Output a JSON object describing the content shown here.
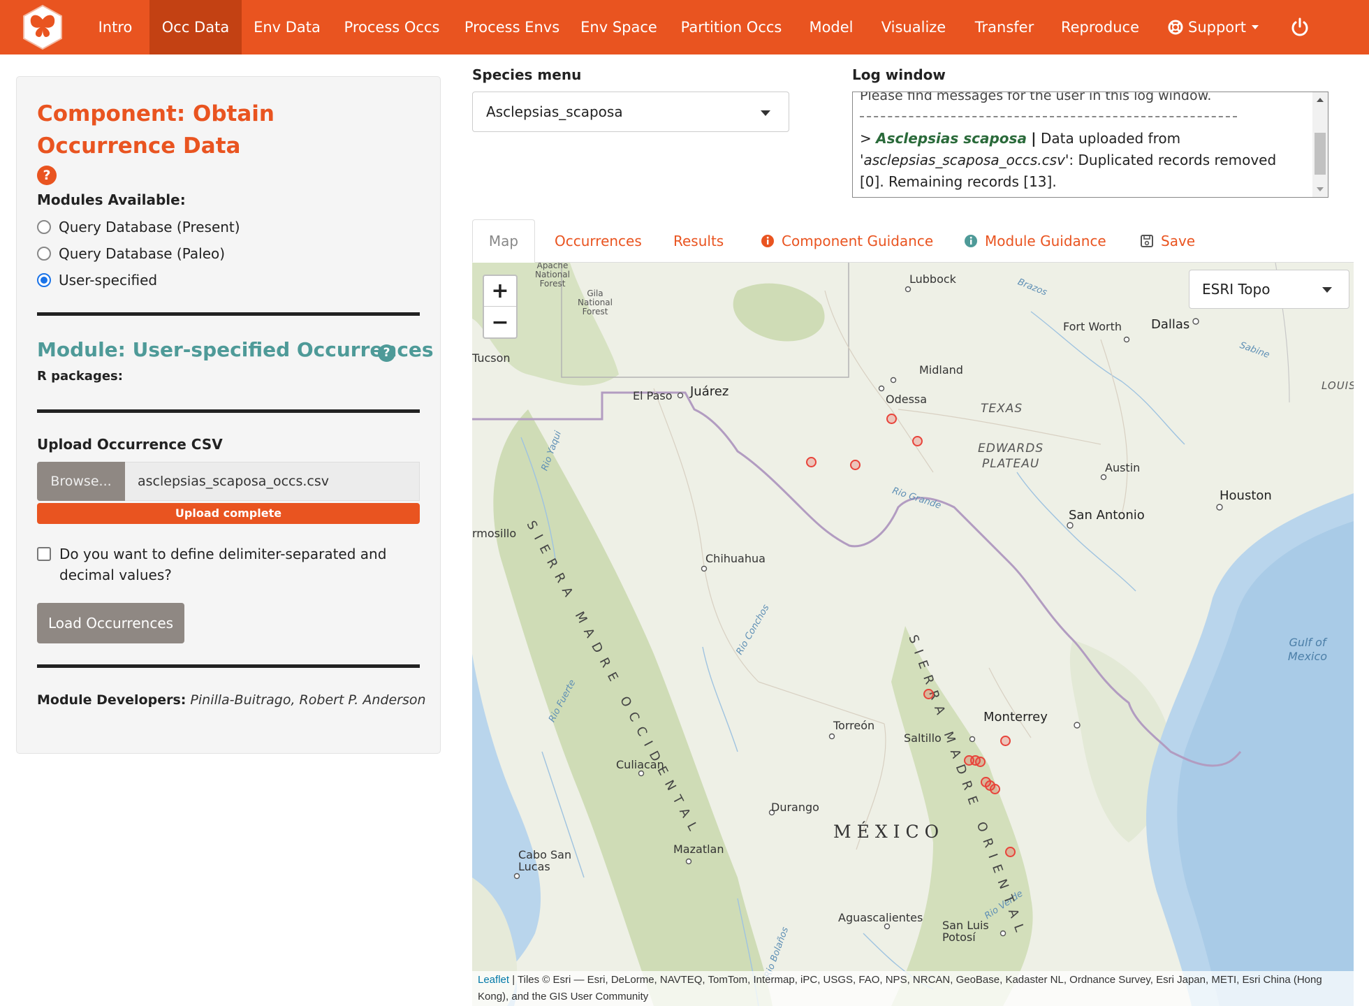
{
  "navbar": {
    "items": [
      "Intro",
      "Occ Data",
      "Env Data",
      "Process Occs",
      "Process Envs",
      "Env Space",
      "Partition Occs",
      "Model",
      "Visualize",
      "Transfer",
      "Reproduce",
      "Support"
    ],
    "active": "Occ Data",
    "logo_icon": "butterfly-logo-icon",
    "support_icon": "life-ring-icon",
    "power_icon": "power-icon"
  },
  "sidebar": {
    "component_title": "Component: Obtain Occurrence Data",
    "component_help": "?",
    "modules_label": "Modules Available:",
    "modules": [
      {
        "label": "Query Database (Present)",
        "checked": false
      },
      {
        "label": "Query Database (Paleo)",
        "checked": false
      },
      {
        "label": "User-specified",
        "checked": true
      }
    ],
    "module_title": "Module: User-specified Occurrences",
    "module_help": "?",
    "rpackages_label": "R packages:",
    "upload_label": "Upload Occurrence CSV",
    "browse_label": "Browse...",
    "file_name": "asclepsias_scaposa_occs.csv",
    "upload_status": "Upload complete",
    "upload_progress": 1.0,
    "delimiter_label": "Do you want to define delimiter-separated and decimal values?",
    "delimiter_checked": false,
    "load_button": "Load Occurrences",
    "developers_label": "Module Developers:",
    "developers": "Pinilla-Buitrago, Robert P. Anderson"
  },
  "species": {
    "label": "Species menu",
    "selected": "Asclepsias_scaposa"
  },
  "log": {
    "label": "Log window",
    "intro": "Please find messages for the user in this log window.",
    "prefix": ">",
    "species": "Asclepsias scaposa",
    "separator": "|",
    "msg_part1": "Data uploaded from",
    "file": "'asclepsias_scaposa_occs.csv'",
    "msg_part2": ": Duplicated records removed [0]. Remaining records [13]."
  },
  "tabs": {
    "items": [
      "Map",
      "Occurrences",
      "Results",
      "Component Guidance",
      "Module Guidance",
      "Save"
    ],
    "active": "Map",
    "icons": [
      "",
      "",
      "",
      "info-circle-icon",
      "info-circle-icon",
      "floppy-disk-icon"
    ]
  },
  "map": {
    "zoom_in": "+",
    "zoom_out": "−",
    "basemap": "ESRI Topo",
    "labels": {
      "lubbock": "Lubbock",
      "fort_worth": "Fort Worth",
      "dallas": "Dallas",
      "midland": "Midland",
      "odessa": "Odessa",
      "texas": "TEXAS",
      "edwards1": "EDWARDS",
      "edwards2": "PLATEAU",
      "austin": "Austin",
      "houston": "Houston",
      "san_antonio": "San Antonio",
      "el_paso": "El Paso",
      "juarez": "Juárez",
      "tucson": "Tucson",
      "hermosillo": "rmosillo",
      "chihuahua": "Chihuahua",
      "monterrey": "Monterrey",
      "torreon": "Torreón",
      "saltillo": "Saltillo",
      "culiacan": "Culiacan",
      "durango": "Durango",
      "mexico": "MÉXICO",
      "mazatlan": "Mazatlan",
      "cabo1": "Cabo San",
      "cabo2": "Lucas",
      "aguascalientes": "Aguascalientes",
      "slp1": "San Luis",
      "slp2": "Potosí",
      "louis": "LOUIS",
      "gila": "Gila National Forest",
      "apache": "Apache National Forest",
      "gulf": "Gulf of Mexico",
      "brazos": "Brazos",
      "sabine": "Sabine",
      "rio_grande": "Rio Grande",
      "rio_conchos": "Rio Conchos",
      "rio_yaqui": "Rio Yaqui",
      "rio_fuerte": "Rio Fuerte",
      "rio_verde": "Rio Verde",
      "rio_bolanos": "Rio Bolaños",
      "sierra_occ": "SIERRA MADRE OCCIDENTAL",
      "sierra_or": "SIERRA MADRE ORIENTAL"
    },
    "occurrence_count": 13,
    "attribution_leaflet": "Leaflet",
    "attribution_text": " | Tiles © Esri — Esri, DeLorme, NAVTEQ, TomTom, Intermap, iPC, USGS, FAO, NPS, NRCAN, GeoBase, Kadaster NL, Ordnance Survey, Esri Japan, METI, Esri China (Hong Kong), and the GIS User Community"
  },
  "colors": {
    "primary": "#e95420",
    "module_teal": "#4e9a98",
    "occurrence_marker": "#e8433a"
  }
}
